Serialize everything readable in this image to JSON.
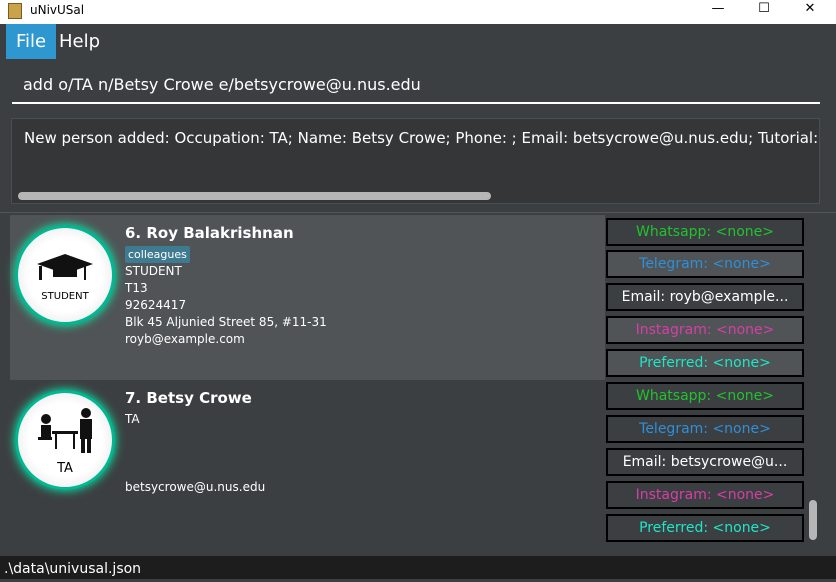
{
  "window": {
    "title": "uNivUSal",
    "minimize": "—",
    "maximize": "☐",
    "close": "✕"
  },
  "menu": {
    "file": "File",
    "help": "Help"
  },
  "command": {
    "value": "add o/TA n/Betsy Crowe e/betsycrowe@u.nus.edu"
  },
  "result": {
    "text": "New person added: Occupation: TA; Name: Betsy Crowe; Phone: ; Email: betsycrowe@u.nus.edu; Tutorial: ; Ac"
  },
  "persons": [
    {
      "index_name": "6.  Roy Balakrishnan",
      "tag": "colleagues",
      "occupation": "STUDENT",
      "tutorial": "T13",
      "phone": "92624417",
      "address": "Blk 45 Aljunied Street 85, #11-31",
      "email": "royb@example.com",
      "avatar_label": "STUDENT",
      "socials": {
        "whatsapp": "Whatsapp: <none>",
        "telegram": "Telegram: <none>",
        "email": "Email: royb@example...",
        "instagram": "Instagram: <none>",
        "preferred": "Preferred: <none>"
      }
    },
    {
      "index_name": "7.  Betsy Crowe",
      "occupation": "TA",
      "email": "betsycrowe@u.nus.edu",
      "avatar_label": "TA",
      "socials": {
        "whatsapp": "Whatsapp: <none>",
        "telegram": "Telegram: <none>",
        "email": "Email: betsycrowe@u...",
        "instagram": "Instagram: <none>",
        "preferred": "Preferred: <none>"
      }
    }
  ],
  "colors": {
    "whatsapp": "#22c22e",
    "telegram": "#2f8fd8",
    "email": "#ffffff",
    "instagram": "#d63fa6",
    "preferred": "#1ee6c8",
    "accent": "#2f97d0"
  },
  "status": {
    "path": ".\\data\\univusal.json"
  }
}
